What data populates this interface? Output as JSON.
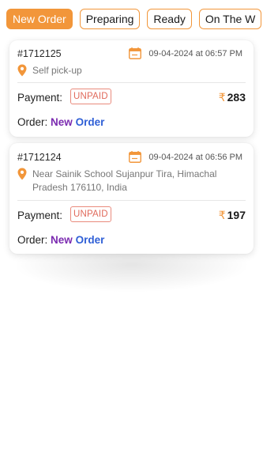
{
  "tabs": [
    {
      "label": "New Order",
      "active": true
    },
    {
      "label": "Preparing",
      "active": false
    },
    {
      "label": "Ready",
      "active": false
    },
    {
      "label": "On The W",
      "active": false
    }
  ],
  "orders": [
    {
      "id": "#1712125",
      "datetime": "09-04-2024 at 06:57 PM",
      "address": "Self pick-up",
      "payment_label": "Payment:",
      "payment_status": "UNPAID",
      "currency": "₹",
      "amount": "283",
      "order_label": "Order:",
      "status_word1": "New",
      "status_word2": "Order"
    },
    {
      "id": "#1712124",
      "datetime": "09-04-2024 at 06:56 PM",
      "address": "Near Sainik School Sujanpur Tira, Himachal Pradesh 176110, India",
      "payment_label": "Payment:",
      "payment_status": "UNPAID",
      "currency": "₹",
      "amount": "197",
      "order_label": "Order:",
      "status_word1": "New",
      "status_word2": "Order"
    }
  ],
  "colors": {
    "accent": "#f2963a",
    "unpaid": "#e0695a",
    "status_purple": "#7b2bb0",
    "status_blue": "#2f5fd6"
  },
  "icons": {
    "date": "calendar-icon",
    "address": "location-pin-icon",
    "currency": "rupee-icon"
  }
}
